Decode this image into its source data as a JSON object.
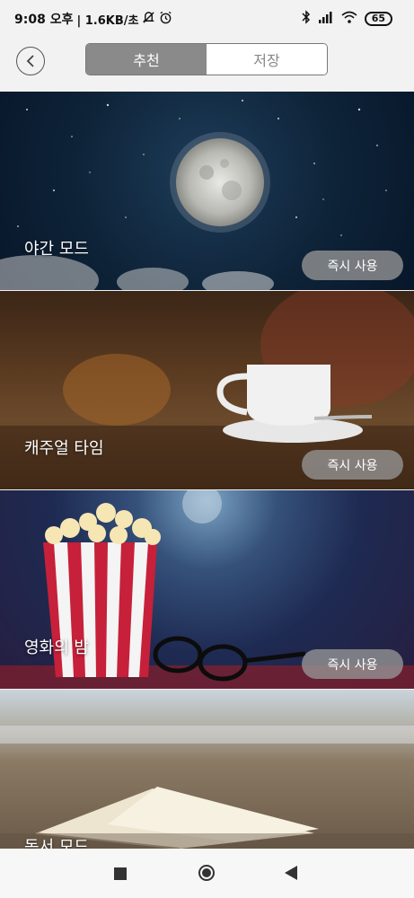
{
  "status": {
    "time": "9:08 오후",
    "speed": "| 1.6KB/초",
    "battery": "65"
  },
  "header": {
    "tabs": [
      {
        "label": "추천",
        "active": true
      },
      {
        "label": "저장",
        "active": false
      }
    ]
  },
  "cards": [
    {
      "title": "야간 모드",
      "action": "즉시 사용"
    },
    {
      "title": "캐주얼 타임",
      "action": "즉시 사용"
    },
    {
      "title": "영화의 밤",
      "action": "즉시 사용"
    },
    {
      "title": "독서 모드"
    }
  ],
  "colors": {
    "active_tab": "#8a8a8a",
    "button": "#969696"
  }
}
